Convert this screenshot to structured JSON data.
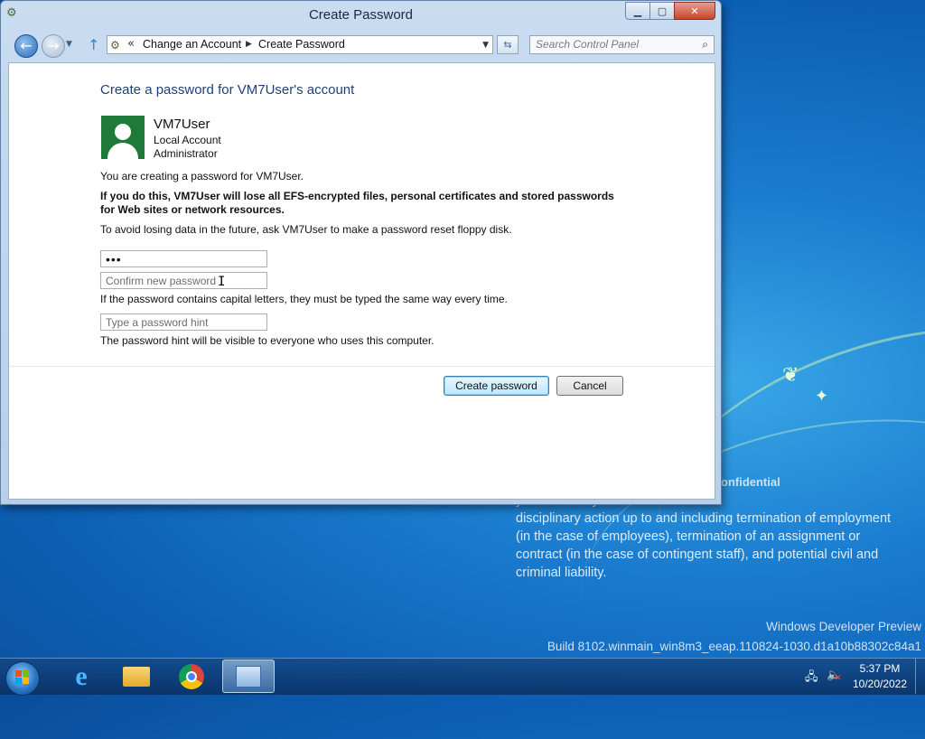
{
  "window": {
    "title": "Create Password",
    "caption": {
      "minimize": "▁",
      "maximize": "▢",
      "close": "✕"
    }
  },
  "navbar": {
    "breadcrumb": [
      "Change an Account",
      "Create Password"
    ],
    "search_placeholder": "Search Control Panel"
  },
  "content": {
    "heading": "Create a password for VM7User's account",
    "user": {
      "name": "VM7User",
      "account_type": "Local Account",
      "role": "Administrator"
    },
    "intro": "You are creating a password for VM7User.",
    "warning": "If you do this, VM7User will lose all EFS-encrypted files, personal certificates and stored passwords for Web sites or network resources.",
    "advice": "To avoid losing data in the future, ask VM7User to make a password reset floppy disk.",
    "new_password_value": "•••",
    "confirm_placeholder": "Confirm new password",
    "capital_note": "If the password contains capital letters, they must be typed the same way every time.",
    "hint_placeholder": "Type a password hint",
    "hint_note": "The password hint will be visible to everyone who uses this computer.",
    "buttons": {
      "create": "Create password",
      "cancel": "Cancel"
    }
  },
  "desktop": {
    "confidential_title": "onfidential",
    "confidential_body": "y manner may result in\ndisciplinary action up to and including termination of employment\n(in the case of employees), termination of an assignment or\ncontract (in the case of contingent staff), and potential civil and\ncriminal liability.",
    "watermark_line1": "Windows Developer Preview",
    "watermark_line2": "Build 8102.winmain_win8m3_eeap.110824-1030.d1a10b88302c84a1"
  },
  "taskbar": {
    "items": [
      "start-button",
      "internet-explorer",
      "windows-explorer",
      "google-chrome",
      "control-panel"
    ],
    "clock_time": "5:37 PM",
    "clock_date": "10/20/2022"
  },
  "colors": {
    "heading": "#1e3f7a",
    "avatar_bg": "#1f7a3a",
    "desktop_bg": "#1a7ccf",
    "close_button": "#c8452c"
  }
}
